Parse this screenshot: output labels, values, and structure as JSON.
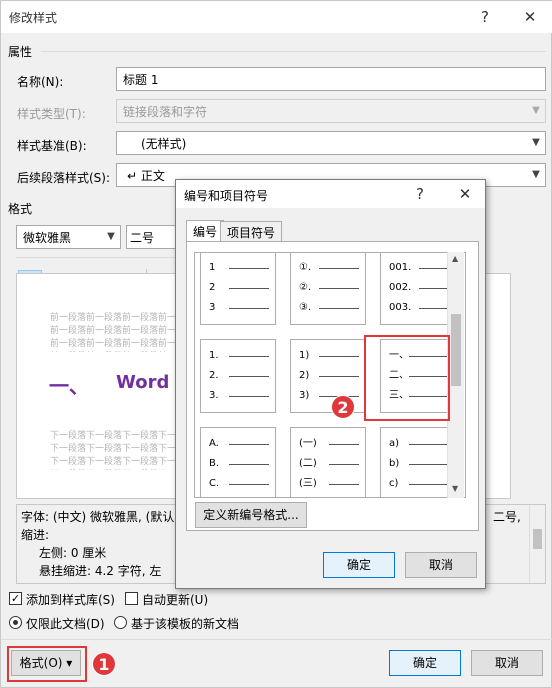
{
  "main_dialog": {
    "title": "修改样式",
    "help": "?",
    "close": "✕",
    "properties_section": "属性",
    "name_label": "名称(N):",
    "name_value": "标题 1",
    "style_type_label": "样式类型(T):",
    "style_type_value": "链接段落和字符",
    "style_based_label": "样式基准(B):",
    "style_based_value": "(无样式)",
    "next_style_label": "后续段落样式(S):",
    "next_style_value": "↵ 正文",
    "format_section": "格式",
    "font_value": "微软雅黑",
    "size_value": "二号",
    "preview": {
      "prev_text": "前一段落前一段落前一段落前一段落前一段落前一段落前一段落前一段落前一段落前一段落前一段落前一段落前一段落前一段落前一段落前一段落前一段落前一段落前一段落",
      "heading_num": "一、",
      "heading_text": "Word",
      "next_text": "下一段落下一段落下一段落下一段落下一段落下一段落下一段落下一段落下一段落下一段落下一段落下一段落下一段落下一段落下一段落下一段落下一段落下一段落下一段落下一段落下一段落"
    },
    "description": {
      "line1": "字体: (中文) 微软雅黑, (默认)",
      "line1_tail": "二号,",
      "line2": "缩进:",
      "line3": "左侧: 0 厘米",
      "line4": "悬挂缩进: 4.2 字符, 左"
    },
    "add_to_gallery": "添加到样式库(S)",
    "auto_update": "自动更新(U)",
    "only_this_doc": "仅限此文档(D)",
    "new_doc_template": "基于该模板的新文档",
    "format_button": "格式(O) ▾",
    "ok": "确定",
    "cancel": "取消"
  },
  "numbering_dialog": {
    "title": "编号和项目符号",
    "help": "?",
    "close": "✕",
    "tab_numbering": "编号",
    "tab_bullets": "项目符号",
    "gallery": [
      [
        "1",
        "2",
        "3"
      ],
      [
        "①.",
        "②.",
        "③."
      ],
      [
        "001.",
        "002.",
        "003."
      ],
      [
        "1.",
        "2.",
        "3."
      ],
      [
        "1)",
        "2)",
        "3)"
      ],
      [
        "一、",
        "二、",
        "三、"
      ],
      [
        "A.",
        "B.",
        "C."
      ],
      [
        "(一)",
        "(二)",
        "(三)"
      ],
      [
        "a)",
        "b)",
        "c)"
      ]
    ],
    "define_button": "定义新编号格式...",
    "ok": "确定",
    "cancel": "取消"
  },
  "annotations": {
    "badge1": "1",
    "badge2": "2"
  },
  "colors": {
    "heading": "#7030a0",
    "annotation_red": "#e0373a",
    "accent_blue": "#0078d7"
  }
}
